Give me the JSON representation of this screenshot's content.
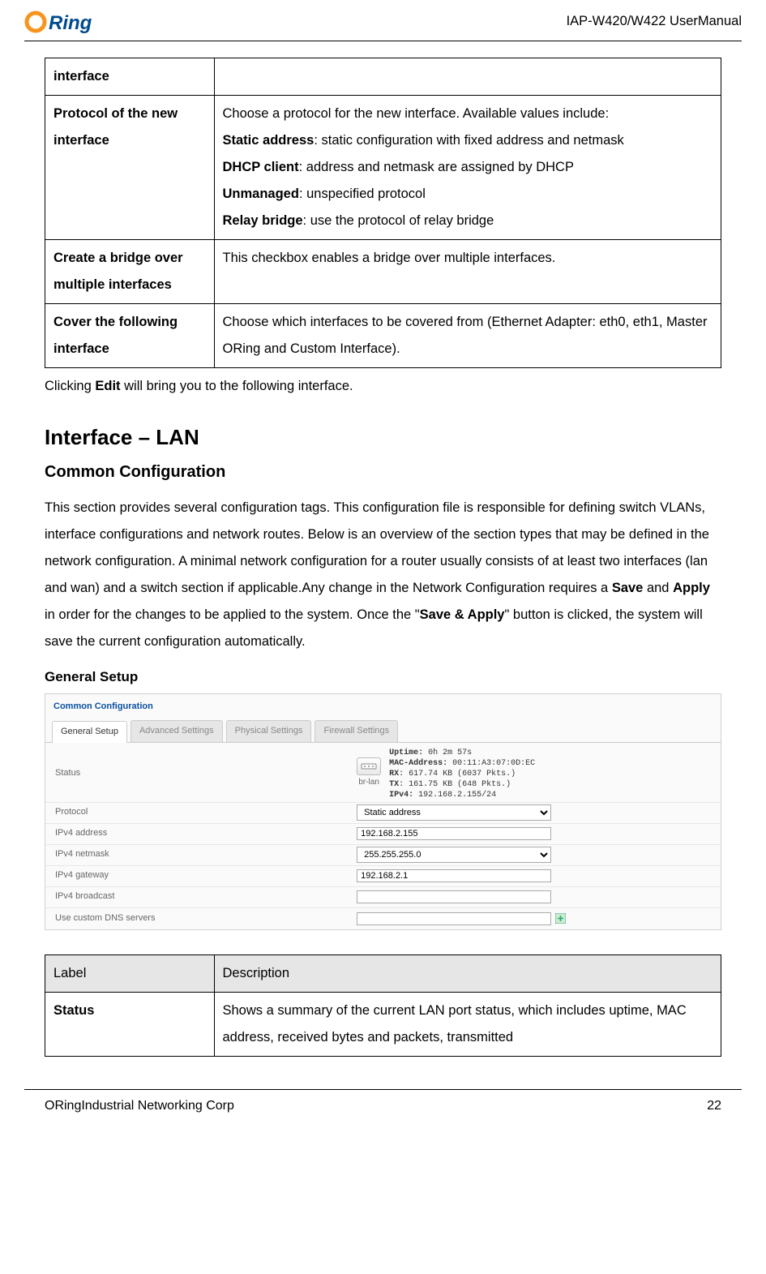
{
  "header": {
    "logo_text": "ORing",
    "doc_title": "IAP-W420/W422  UserManual"
  },
  "table1": {
    "rows": [
      {
        "label": "interface",
        "desc": ""
      },
      {
        "label": "Protocol of the new interface",
        "desc_intro": "Choose a protocol for the new interface. Available values include:",
        "lines": [
          {
            "b": "Static address",
            "t": ": static configuration with fixed address and netmask"
          },
          {
            "b": "DHCP client",
            "t": ": address and netmask are assigned by DHCP"
          },
          {
            "b": "Unmanaged",
            "t": ": unspecified protocol"
          },
          {
            "b": "Relay bridge",
            "t": ": use the protocol of relay bridge"
          }
        ]
      },
      {
        "label": "Create a bridge over multiple interfaces",
        "desc": "This checkbox enables a bridge over multiple interfaces."
      },
      {
        "label": "Cover the following interface",
        "desc": "Choose which interfaces to be covered from (Ethernet Adapter: eth0, eth1, Master ORing and Custom Interface)."
      }
    ]
  },
  "after_table_text_pre": "Clicking ",
  "after_table_text_bold": "Edit",
  "after_table_text_post": " will bring you to the following interface.",
  "section": {
    "title": "Interface – LAN",
    "subtitle": "Common Configuration"
  },
  "para_parts": [
    {
      "t": "This section provides several configuration tags. This configuration file is responsible for defining switch VLANs, interface configurations and network routes. Below is an overview of the section types that may be defined in the network configuration. A minimal network configuration for a router usually consists of at least two interfaces (lan and wan) and a switch section if applicable.Any change in the Network Configuration requires a "
    },
    {
      "b": "Save"
    },
    {
      "t": " and "
    },
    {
      "b": "Apply"
    },
    {
      "t": " in order for the changes to be applied to the system. Once the \""
    },
    {
      "b": "Save & Apply"
    },
    {
      "t": "\" button is clicked, the system will save the current configuration automatically."
    }
  ],
  "setup_heading": "General Setup",
  "config_panel": {
    "title": "Common Configuration",
    "tabs": [
      "General Setup",
      "Advanced Settings",
      "Physical Settings",
      "Firewall Settings"
    ],
    "status": {
      "label": "Status",
      "device": "br-lan",
      "uptime_key": "Uptime:",
      "uptime": "0h 2m 57s",
      "mac_key": "MAC-Address:",
      "mac": "00:11:A3:07:0D:EC",
      "rx_key": "RX",
      "rx": ": 617.74 KB (6037 Pkts.)",
      "tx_key": "TX",
      "tx": ": 161.75 KB (648 Pkts.)",
      "ipv4_key": "IPv4:",
      "ipv4": "192.168.2.155/24"
    },
    "rows": [
      {
        "label": "Protocol",
        "type": "select",
        "value": "Static address"
      },
      {
        "label": "IPv4 address",
        "type": "text",
        "value": "192.168.2.155"
      },
      {
        "label": "IPv4 netmask",
        "type": "select",
        "value": "255.255.255.0"
      },
      {
        "label": "IPv4 gateway",
        "type": "text",
        "value": "192.168.2.1"
      },
      {
        "label": "IPv4 broadcast",
        "type": "text",
        "value": ""
      },
      {
        "label": "Use custom DNS servers",
        "type": "text",
        "value": "",
        "add": true
      }
    ]
  },
  "table2": {
    "header": {
      "c1": "Label",
      "c2": "Description"
    },
    "row1": {
      "label": "Status",
      "desc": "Shows a summary of the current LAN port status, which includes uptime, MAC address, received bytes and packets, transmitted"
    }
  },
  "footer": {
    "company": "ORingIndustrial Networking Corp",
    "page": "22"
  }
}
